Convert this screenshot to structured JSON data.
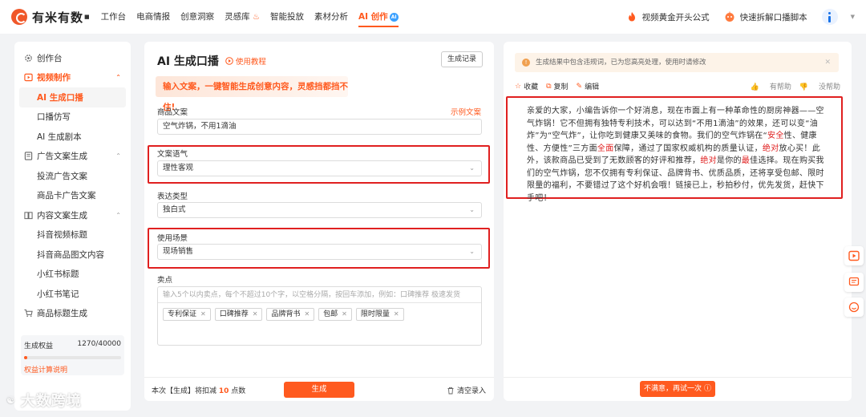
{
  "brand": {
    "name": "有米有数",
    "sup": "■"
  },
  "nav": [
    {
      "label": "工作台"
    },
    {
      "label": "电商情报"
    },
    {
      "label": "创意洞察"
    },
    {
      "label": "灵感库"
    },
    {
      "label": "智能投放"
    },
    {
      "label": "素材分析"
    },
    {
      "label": "AI 创作",
      "badge": "AI"
    }
  ],
  "top_right": {
    "formula": "视频黄金开头公式",
    "script_tool": "快速拆解口播脚本"
  },
  "colors": {
    "accent": "#ff5a1f",
    "highlight_red": "#e02020"
  },
  "sidebar": {
    "workbench": "创作台",
    "groups": [
      {
        "label": "视频制作",
        "items": [
          "AI 生成口播",
          "口播仿写",
          "AI 生成剧本"
        ]
      },
      {
        "label": "广告文案生成",
        "items": [
          "投流广告文案",
          "商品卡广告文案"
        ]
      },
      {
        "label": "内容文案生成",
        "items": [
          "抖音视频标题",
          "抖音商品图文内容",
          "小红书标题",
          "小红书笔记"
        ]
      },
      {
        "label": "商品标题生成"
      }
    ],
    "quota": {
      "label": "生成权益",
      "value": "1270/40000",
      "fraction": 0.03175,
      "link": "权益计算说明"
    }
  },
  "form": {
    "title": "AI 生成口播",
    "tutorial": "使用教程",
    "records_button": "生成记录",
    "banner": "输入文案，一键智能生成创意内容，灵感挡都挡不住!",
    "product_copy": {
      "label": "商品文案",
      "example_link": "示例文案",
      "value": "空气炸锅，不用1滴油"
    },
    "tone": {
      "label": "文案语气",
      "value": "理性客观"
    },
    "expression": {
      "label": "表达类型",
      "value": "独白式"
    },
    "scene": {
      "label": "使用场景",
      "value": "现场销售"
    },
    "selling_points": {
      "label": "卖点",
      "placeholder": "输入5个以内卖点，每个不超过10个字，以空格分隔，按回车添加，例如：口碑推荐 极速发货",
      "tags": [
        "专利保证",
        "口碑推荐",
        "品牌背书",
        "包邮",
        "限时限量"
      ]
    },
    "footer": {
      "cost_prefix": "本次【生成】将扣减",
      "cost_value": "10",
      "cost_suffix": "点数",
      "generate": "生成",
      "clear": "清空录入"
    }
  },
  "result": {
    "notice": "生成结果中包含违规词，已为您高亮处理，使用时请修改",
    "actions": {
      "collect": "收藏",
      "copy": "复制",
      "edit": "编辑"
    },
    "feedback": {
      "helpful": "有帮助",
      "unhelpful": "没帮助"
    },
    "text": "亲爱的大家，小编告诉你一个好消息，现在市面上有一种革命性的厨房神器——空气炸锅！它不但拥有独特专利技术，可以达到“不用1滴油”的效果，还可以变“油炸”为“空气炸”，让你吃到健康又美味的食物。我们的空气炸锅在“安全性、健康性、方便性”三方面全面保障，通过了国家权威机构的质量认证，绝对放心买！此外，该款商品已受到了无数顾客的好评和推荐，绝对是你的最佳选择。现在购买我们的空气炸锅，您不仅拥有专利保证、品牌背书、优质品质，还将享受包邮、限时限量的福利，不要错过了这个好机会哦！链接已上，秒拍秒付，优先发货，赶快下手吧！",
    "highlighted_words": [
      "安全",
      "全面",
      "绝对",
      "绝对",
      "最"
    ],
    "retry": "不满意，再试一次"
  },
  "watermark": "大数跨境"
}
